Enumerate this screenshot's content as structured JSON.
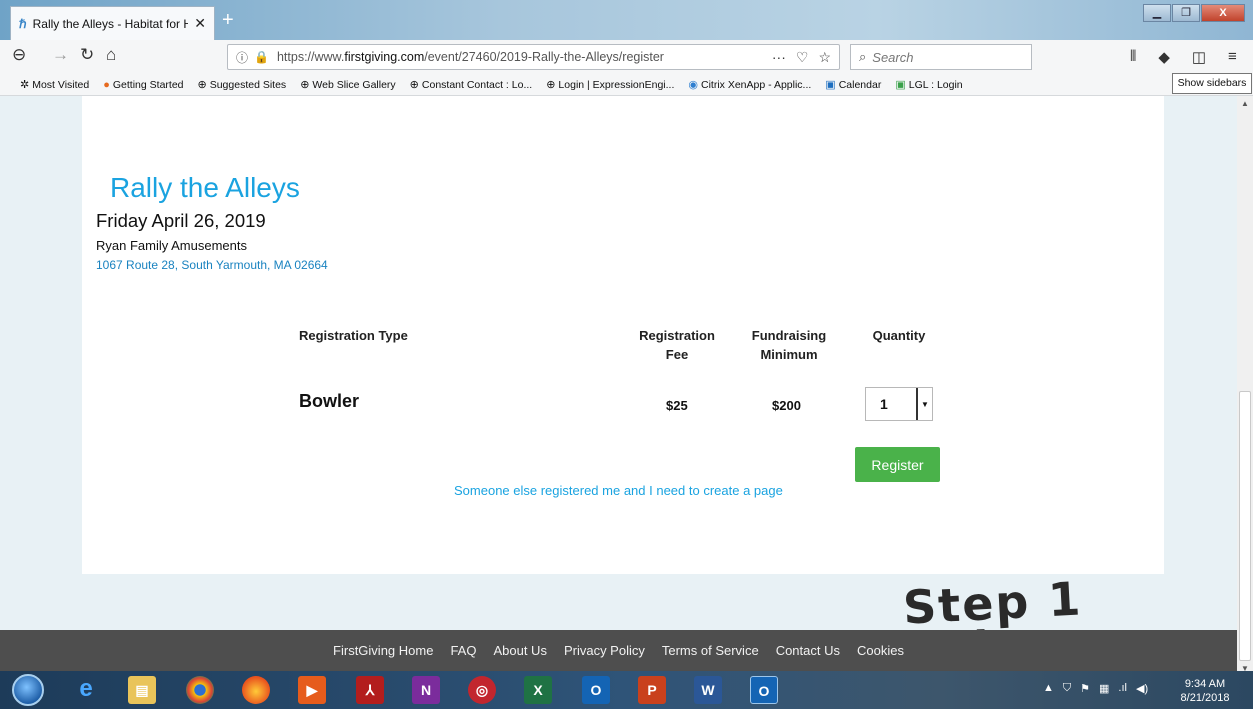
{
  "browser": {
    "tab_title": "Rally the Alleys - Habitat for H",
    "tab_favicon": "habitat-favicon",
    "new_tab": "+",
    "url_prefix": "https://www.",
    "url_domain": "firstgiving.com",
    "url_path": "/event/27460/2019-Rally-the-Alleys/register",
    "search_placeholder": "Search",
    "tooltip": "Show sidebars",
    "bookmarks": [
      {
        "label": "Most Visited",
        "icon": "gear-icon"
      },
      {
        "label": "Getting Started",
        "icon": "firefox-icon"
      },
      {
        "label": "Suggested Sites",
        "icon": "globe-icon"
      },
      {
        "label": "Web Slice Gallery",
        "icon": "globe-icon"
      },
      {
        "label": "Constant Contact : Lo...",
        "icon": "globe-icon"
      },
      {
        "label": "Login | ExpressionEngi...",
        "icon": "globe-icon"
      },
      {
        "label": "Citrix XenApp - Applic...",
        "icon": "citrix-icon"
      },
      {
        "label": "Calendar",
        "icon": "outlook-icon"
      },
      {
        "label": "LGL : Login",
        "icon": "lgl-icon"
      }
    ]
  },
  "event": {
    "title": "Rally the Alleys",
    "date": "Friday April 26, 2019",
    "venue": "Ryan Family Amusements",
    "address": "1067 Route 28, South Yarmouth, MA 02664"
  },
  "registration": {
    "headers": {
      "type": "Registration Type",
      "fee_line1": "Registration",
      "fee_line2": "Fee",
      "min_line1": "Fundraising",
      "min_line2": "Minimum",
      "quantity": "Quantity"
    },
    "rows": [
      {
        "type": "Bowler",
        "fee": "$25",
        "minimum": "$200",
        "quantity": "1"
      }
    ],
    "register_label": "Register",
    "create_page_link": "Someone else registered me and I need to create a page"
  },
  "annotation": {
    "line1": "Step 1",
    "line2": "Click Register"
  },
  "footer": {
    "links": [
      "FirstGiving Home",
      "FAQ",
      "About Us",
      "Privacy Policy",
      "Terms of Service",
      "Contact Us",
      "Cookies"
    ]
  },
  "taskbar": {
    "time": "9:34 AM",
    "date": "8/21/2018"
  },
  "colors": {
    "title_blue": "#1aa3e0",
    "register_green": "#4ab24a",
    "footer_bg": "#4e4e4e"
  }
}
